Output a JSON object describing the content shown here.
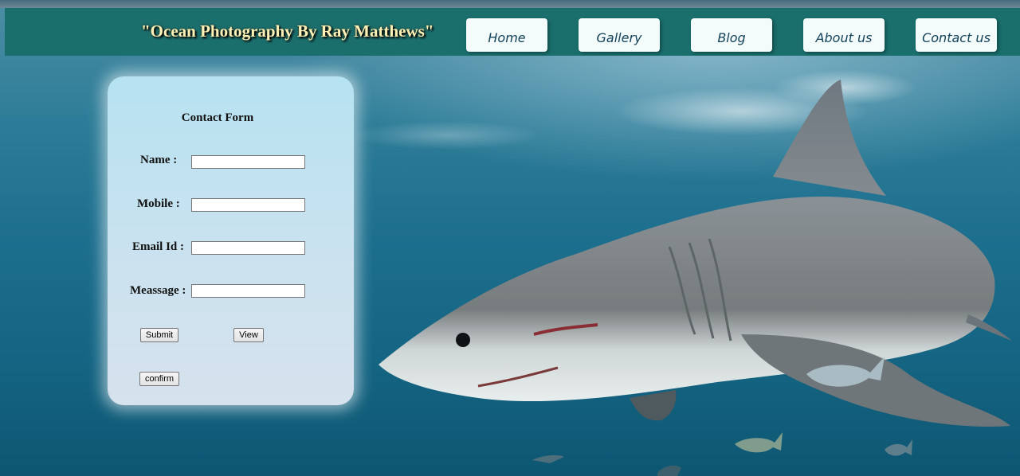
{
  "header": {
    "site_title": "\"Ocean Photography By Ray Matthews\""
  },
  "nav": {
    "items": [
      {
        "label": "Home"
      },
      {
        "label": "Gallery"
      },
      {
        "label": "Blog"
      },
      {
        "label": "About us"
      },
      {
        "label": "Contact us"
      }
    ]
  },
  "contact_form": {
    "title": "Contact Form",
    "fields": [
      {
        "label": "Name :",
        "value": ""
      },
      {
        "label": "Mobile :",
        "value": ""
      },
      {
        "label": "Email Id :",
        "value": ""
      },
      {
        "label": "Meassage :",
        "value": ""
      }
    ],
    "buttons": {
      "submit": "Submit",
      "view": "View",
      "confirm": "confirm"
    }
  },
  "colors": {
    "header_bg": "#1a6f6d",
    "nav_button_bg": "#f3fbfb",
    "nav_text": "#13435a",
    "title_text": "#fff2b8"
  }
}
